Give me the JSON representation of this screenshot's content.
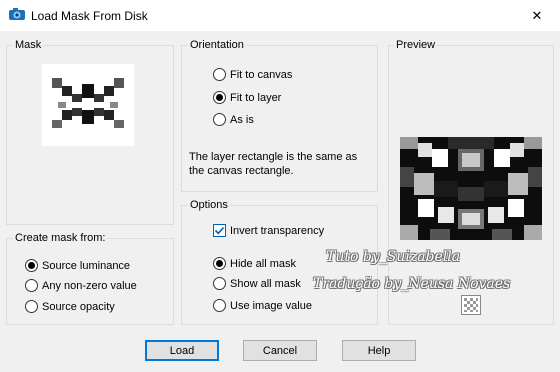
{
  "window": {
    "title": "Load Mask From Disk",
    "close_glyph": "✕"
  },
  "mask": {
    "legend": "Mask"
  },
  "orientation": {
    "legend": "Orientation",
    "options": [
      {
        "label": "Fit to canvas",
        "selected": false
      },
      {
        "label": "Fit to layer",
        "selected": true
      },
      {
        "label": "As is",
        "selected": false
      }
    ],
    "info": "The layer rectangle is the same as the canvas rectangle."
  },
  "preview": {
    "legend": "Preview"
  },
  "create_mask_from": {
    "legend": "Create mask from:",
    "options": [
      {
        "label": "Source luminance",
        "selected": true
      },
      {
        "label": "Any non-zero value",
        "selected": false
      },
      {
        "label": "Source opacity",
        "selected": false
      }
    ]
  },
  "options": {
    "legend": "Options",
    "invert_label": "Invert transparency",
    "invert_checked": true,
    "radios": [
      {
        "label": "Hide all mask",
        "selected": true
      },
      {
        "label": "Show all mask",
        "selected": false
      },
      {
        "label": "Use image value",
        "selected": false
      }
    ]
  },
  "buttons": {
    "load": "Load",
    "cancel": "Cancel",
    "help": "Help"
  },
  "watermark": {
    "line1": "Tuto by_Suizabella",
    "line2": "Tradução by_Neusa Novaes"
  },
  "colors": {
    "accent": "#0078d7",
    "background": "#f0f0f0"
  }
}
